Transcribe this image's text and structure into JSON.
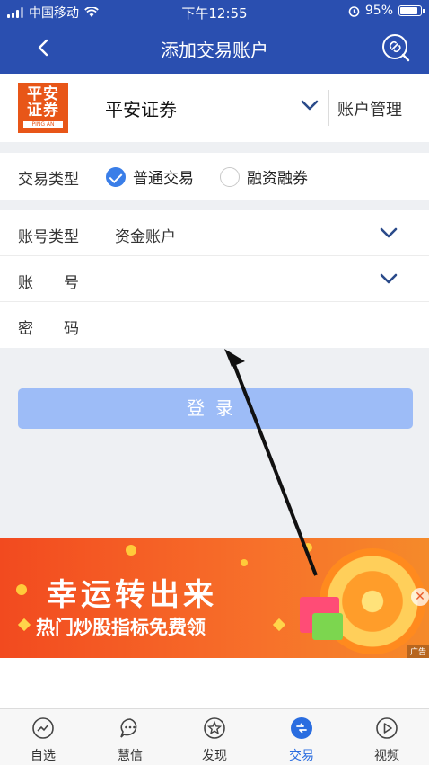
{
  "status_bar": {
    "carrier": "中国移动",
    "time": "下午12:55",
    "battery": "95%"
  },
  "nav": {
    "title": "添加交易账户"
  },
  "broker": {
    "logo_line1": "平安",
    "logo_line2": "证券",
    "logo_sub": "PING AN",
    "name": "平安证券",
    "manage_label": "账户管理"
  },
  "trade_type": {
    "label": "交易类型",
    "options": [
      "普通交易",
      "融资融券"
    ],
    "selected": "普通交易"
  },
  "form": {
    "account_type_label": "账号类型",
    "account_type_value": "资金账户",
    "account_label": "账　　号",
    "password_label": "密　　码"
  },
  "login_label": "登录",
  "ad": {
    "headline": "幸运转出来",
    "subline": "热门炒股指标免费领",
    "tag": "广告"
  },
  "tabs": [
    {
      "label": "自选",
      "icon": "trend-icon"
    },
    {
      "label": "慧信",
      "icon": "chat-icon"
    },
    {
      "label": "发现",
      "icon": "star-icon"
    },
    {
      "label": "交易",
      "icon": "trade-icon",
      "active": true
    },
    {
      "label": "视频",
      "icon": "play-icon"
    }
  ],
  "colors": {
    "primary": "#2a4fb0",
    "accent": "#3a7ee8",
    "login_disabled": "#9dbcf7"
  }
}
